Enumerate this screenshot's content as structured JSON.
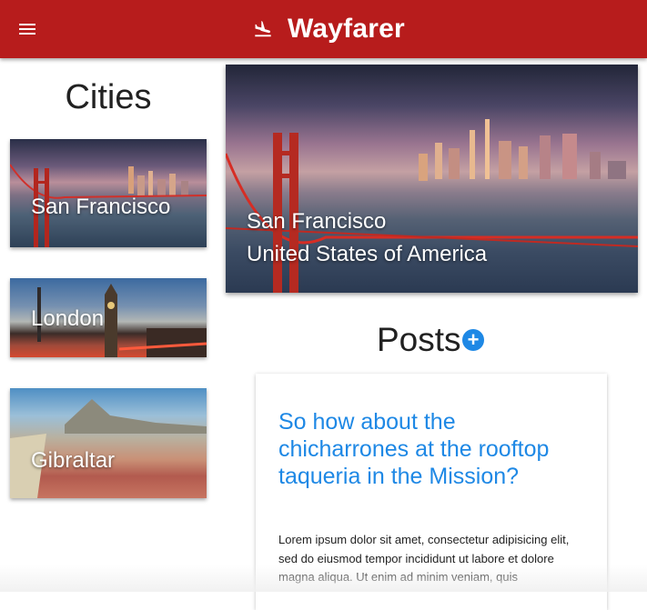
{
  "appbar": {
    "brand": "Wayfarer",
    "brand_icon": "plane-landing-icon",
    "menu_icon": "hamburger-menu-icon",
    "color": "#b71c1c"
  },
  "cities": {
    "heading": "Cities",
    "items": [
      {
        "label": "San Francisco"
      },
      {
        "label": "London"
      },
      {
        "label": "Gibraltar"
      }
    ]
  },
  "hero": {
    "city": "San Francisco",
    "country": "United States of America"
  },
  "posts": {
    "heading": "Posts",
    "add_label": "+",
    "add_icon": "add-circle-icon",
    "accent": "#1e88e5",
    "items": [
      {
        "title": "So how about the chicharrones at the rooftop taqueria in the Mission?",
        "body": "Lorem ipsum dolor sit amet, consectetur adipisicing elit, sed do eiusmod tempor incididunt ut labore et dolore magna aliqua. Ut enim ad minim veniam, quis"
      }
    ]
  }
}
